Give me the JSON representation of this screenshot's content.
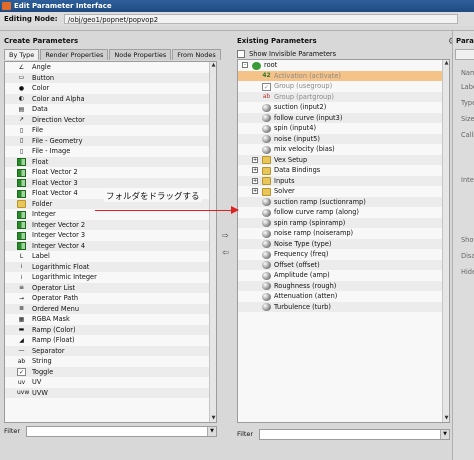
{
  "window": {
    "title": "Edit Parameter Interface"
  },
  "editing": {
    "label": "Editing Node:",
    "path": "/obj/geo1/popnet/popvop2"
  },
  "create": {
    "title": "Create Parameters",
    "tabs": [
      "By Type",
      "Render Properties",
      "Node Properties",
      "From Nodes"
    ],
    "items": [
      {
        "label": "Angle",
        "icon": "angle-icon"
      },
      {
        "label": "Button",
        "icon": "button-icon"
      },
      {
        "label": "Color",
        "icon": "color-icon"
      },
      {
        "label": "Color and Alpha",
        "icon": "color-alpha-icon"
      },
      {
        "label": "Data",
        "icon": "data-icon"
      },
      {
        "label": "Direction Vector",
        "icon": "direction-icon"
      },
      {
        "label": "File",
        "icon": "file-icon"
      },
      {
        "label": "File - Geometry",
        "icon": "file-geometry-icon"
      },
      {
        "label": "File - Image",
        "icon": "file-image-icon"
      },
      {
        "label": "Float",
        "icon": "float-icon"
      },
      {
        "label": "Float Vector 2",
        "icon": "float-vector-icon"
      },
      {
        "label": "Float Vector 3",
        "icon": "float-vector-icon"
      },
      {
        "label": "Float Vector 4",
        "icon": "float-vector-icon"
      },
      {
        "label": "Folder",
        "icon": "folder-icon"
      },
      {
        "label": "Integer",
        "icon": "integer-icon"
      },
      {
        "label": "Integer Vector 2",
        "icon": "integer-vector-icon"
      },
      {
        "label": "Integer Vector 3",
        "icon": "integer-vector-icon"
      },
      {
        "label": "Integer Vector 4",
        "icon": "integer-vector-icon"
      },
      {
        "label": "Label",
        "icon": "label-icon"
      },
      {
        "label": "Logarithmic Float",
        "icon": "log-float-icon"
      },
      {
        "label": "Logarithmic Integer",
        "icon": "log-int-icon"
      },
      {
        "label": "Operator List",
        "icon": "operator-list-icon"
      },
      {
        "label": "Operator Path",
        "icon": "operator-path-icon"
      },
      {
        "label": "Ordered Menu",
        "icon": "ordered-menu-icon"
      },
      {
        "label": "RGBA Mask",
        "icon": "rgba-mask-icon"
      },
      {
        "label": "Ramp (Color)",
        "icon": "ramp-color-icon"
      },
      {
        "label": "Ramp (Float)",
        "icon": "ramp-float-icon"
      },
      {
        "label": "Separator",
        "icon": "separator-icon"
      },
      {
        "label": "String",
        "icon": "string-icon"
      },
      {
        "label": "Toggle",
        "icon": "toggle-icon"
      },
      {
        "label": "UV",
        "icon": "uv-icon"
      },
      {
        "label": "UVW",
        "icon": "uvw-icon"
      }
    ],
    "filter_label": "Filter"
  },
  "existing": {
    "title": "Existing Parameters",
    "show_invisible_label": "Show Invisible Parameters",
    "items": [
      {
        "label": "root",
        "indent": 0,
        "icon": "root-icon",
        "expander": "-"
      },
      {
        "label": "Activation (activate)",
        "indent": 1,
        "icon": "integer-42-icon",
        "highlight": true,
        "grey": true
      },
      {
        "label": "Group (usegroup)",
        "indent": 1,
        "icon": "toggle-icon",
        "grey": true
      },
      {
        "label": "Group (partgroup)",
        "indent": 1,
        "icon": "string-icon",
        "grey": true
      },
      {
        "label": "suction (input2)",
        "indent": 1,
        "icon": "dot-icon"
      },
      {
        "label": "follow curve (input3)",
        "indent": 1,
        "icon": "dot-icon"
      },
      {
        "label": "spin (input4)",
        "indent": 1,
        "icon": "dot-icon"
      },
      {
        "label": "noise (input5)",
        "indent": 1,
        "icon": "dot-icon"
      },
      {
        "label": "mix velocity (bias)",
        "indent": 1,
        "icon": "dot-icon"
      },
      {
        "label": "Vex Setup",
        "indent": 1,
        "icon": "folder-icon",
        "expander": "+"
      },
      {
        "label": "Data Bindings",
        "indent": 1,
        "icon": "folder-icon",
        "expander": "+"
      },
      {
        "label": "Inputs",
        "indent": 1,
        "icon": "folder-icon",
        "expander": "+"
      },
      {
        "label": "Solver",
        "indent": 1,
        "icon": "folder-icon",
        "expander": "+"
      },
      {
        "label": "suction ramp (suctionramp)",
        "indent": 1,
        "icon": "dot-icon"
      },
      {
        "label": "follow curve ramp (along)",
        "indent": 1,
        "icon": "dot-icon"
      },
      {
        "label": "spin ramp (spinramp)",
        "indent": 1,
        "icon": "dot-icon"
      },
      {
        "label": "noise ramp (noiseramp)",
        "indent": 1,
        "icon": "dot-icon"
      },
      {
        "label": "Noise Type (type)",
        "indent": 1,
        "icon": "dot-icon"
      },
      {
        "label": "Frequency (freq)",
        "indent": 1,
        "icon": "dot-icon"
      },
      {
        "label": "Offset (offset)",
        "indent": 1,
        "icon": "dot-icon"
      },
      {
        "label": "Amplitude (amp)",
        "indent": 1,
        "icon": "dot-icon"
      },
      {
        "label": "Roughness (rough)",
        "indent": 1,
        "icon": "dot-icon"
      },
      {
        "label": "Attenuation (atten)",
        "indent": 1,
        "icon": "dot-icon"
      },
      {
        "label": "Turbulence (turb)",
        "indent": 1,
        "icon": "dot-icon"
      }
    ],
    "filter_label": "Filter"
  },
  "right": {
    "title": "Para",
    "labels": [
      "Nam",
      "Labe",
      "Type",
      "Size",
      "Calli",
      "Inte",
      "Show",
      "Disa",
      "Hide"
    ]
  },
  "annotation": {
    "text": "フォルダをドラッグする",
    "color": "#dd2222"
  },
  "colors": {
    "highlight": "#f5c287",
    "titlebar": "#245089"
  }
}
